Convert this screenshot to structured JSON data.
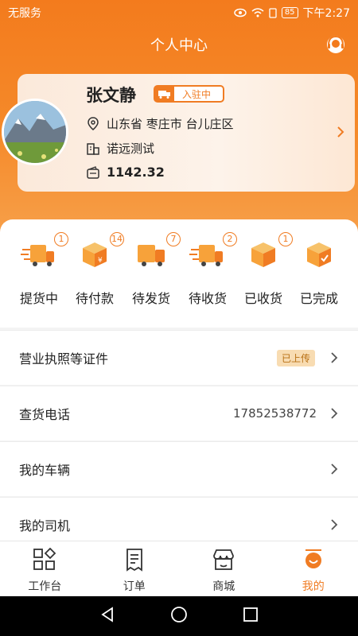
{
  "status_bar": {
    "carrier": "无服务",
    "battery": "85",
    "time": "下午2:27"
  },
  "header": {
    "title": "个人中心"
  },
  "profile": {
    "name": "张文静",
    "badge": "入驻中",
    "location": "山东省 枣庄市 台儿庄区",
    "company": "诺远测试",
    "balance": "1142.32"
  },
  "orders": [
    {
      "label": "提货中",
      "count": "1",
      "icon": "delivery-truck-icon"
    },
    {
      "label": "待付款",
      "count": "14",
      "icon": "box-yuan-icon"
    },
    {
      "label": "待发货",
      "count": "7",
      "icon": "truck-icon"
    },
    {
      "label": "待收货",
      "count": "2",
      "icon": "delivery-truck-icon"
    },
    {
      "label": "已收货",
      "count": "1",
      "icon": "box-icon"
    },
    {
      "label": "已完成",
      "count": "",
      "icon": "box-check-icon"
    }
  ],
  "menu": [
    {
      "label": "营业执照等证件",
      "status": "已上传"
    },
    {
      "label": "查货电话",
      "value": "17852538772"
    },
    {
      "label": "我的车辆"
    },
    {
      "label": "我的司机"
    }
  ],
  "tabs": [
    {
      "label": "工作台",
      "icon": "workbench-icon"
    },
    {
      "label": "订单",
      "icon": "order-icon"
    },
    {
      "label": "商城",
      "icon": "store-icon"
    },
    {
      "label": "我的",
      "icon": "profile-icon",
      "active": true
    }
  ],
  "colors": {
    "accent": "#f07c23",
    "header_gradient_top": "#f37b1d"
  }
}
